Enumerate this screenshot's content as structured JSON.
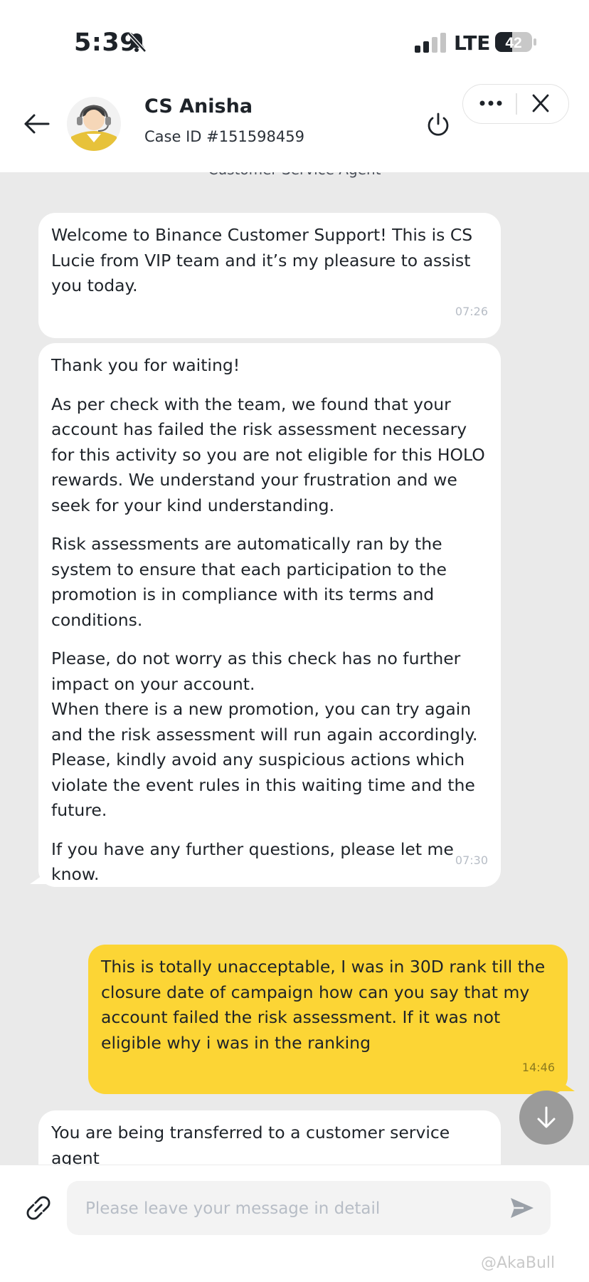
{
  "status_bar": {
    "time": "5:39",
    "network": "LTE",
    "battery": "42"
  },
  "header": {
    "agent_name": "CS Anisha",
    "case_id": "Case ID #151598459"
  },
  "chat": {
    "system_label": "Customer Service Agent",
    "messages": [
      {
        "sender": "agent",
        "paragraphs": [
          "Welcome to Binance Customer Support! This is CS Lucie from VIP team and it’s my pleasure to assist you today."
        ],
        "time": "07:26"
      },
      {
        "sender": "agent",
        "paragraphs": [
          "Thank you for waiting!",
          "As per check with the team, we found that your account has failed the risk assessment necessary for this activity so you are not eligible for this HOLO rewards. We understand your frustration and we seek for your kind understanding.",
          "Risk assessments are automatically ran by the system to ensure that each participation to the promotion is in compliance with its terms and conditions.",
          "Please, do not worry as this check has no further impact on your account.",
          "When there is a new promotion, you can try again and the risk assessment will run again accordingly.",
          "Please, kindly avoid any suspicious actions which violate the event rules in this waiting time and the future.",
          "If you have any further questions, please let me know."
        ],
        "time": "07:30"
      },
      {
        "sender": "user",
        "paragraphs": [
          "This is totally unacceptable, I was in 30D rank till the closure date of campaign how can you say that my account failed the risk assessment. If it was not eligible why i was in the ranking"
        ],
        "time": "14:46"
      },
      {
        "sender": "agent",
        "paragraphs": [
          "You are being transferred to a customer service agent"
        ],
        "time": ""
      }
    ]
  },
  "input": {
    "placeholder": "Please leave your message in detail",
    "value": ""
  },
  "watermark": "@AkaBull",
  "colors": {
    "user_bubble": "#fcd535",
    "agent_bubble": "#ffffff",
    "chat_background": "#eaeaea",
    "text": "#1e2329"
  },
  "icons": [
    "back-arrow-icon",
    "agent-avatar-icon",
    "power-icon",
    "more-icon",
    "close-icon",
    "arrow-down-icon",
    "link-icon",
    "send-icon",
    "bell-slash-icon",
    "signal-icon",
    "battery-icon"
  ]
}
